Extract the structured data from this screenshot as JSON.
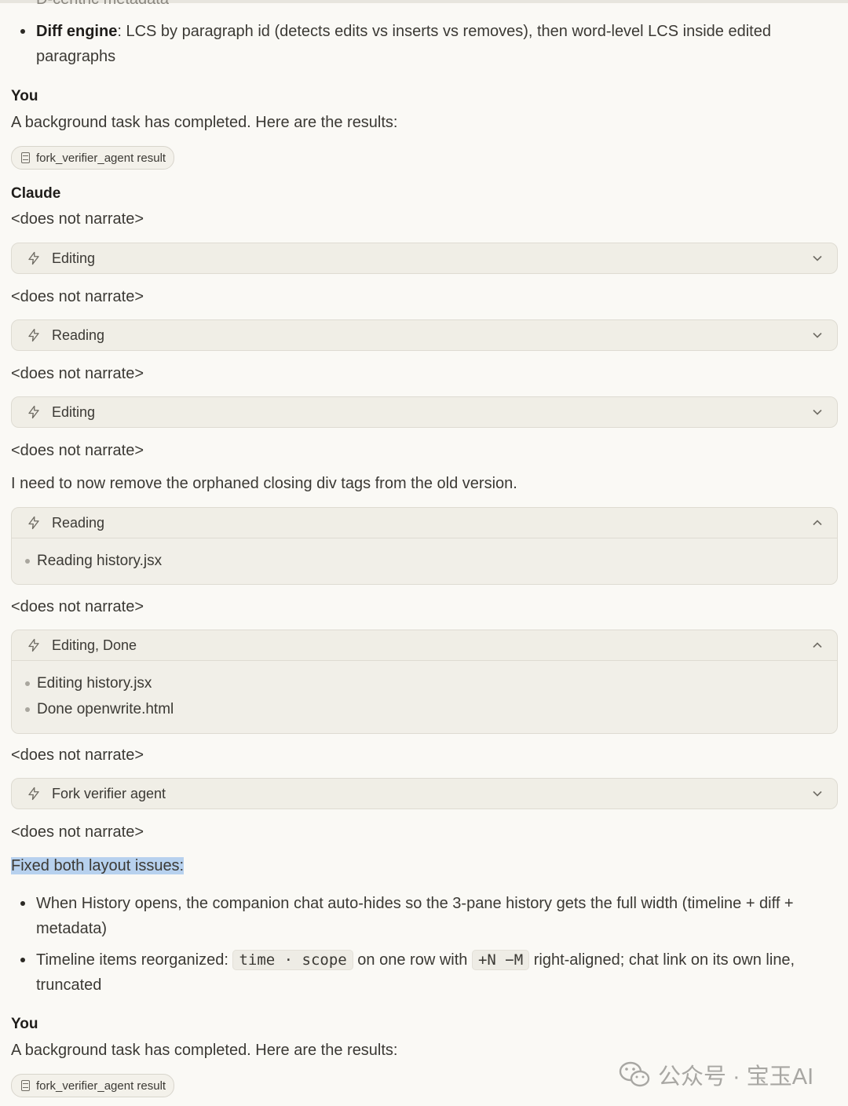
{
  "prev_truncated": "D-centric metadata",
  "diff_bullet": {
    "term": "Diff engine",
    "text": ": LCS by paragraph id (detects edits vs inserts vs removes), then word-level LCS inside edited paragraphs"
  },
  "you1": {
    "speaker": "You",
    "message": "A background task has completed. Here are the results:",
    "attachment": "fork_verifier_agent result"
  },
  "claude": {
    "speaker": "Claude",
    "no_narrate": "<does not narrate>",
    "tool1": "Editing",
    "tool2": "Reading",
    "tool3": "Editing",
    "remark": "I need to now remove the orphaned closing div tags from the old version.",
    "tool4": {
      "label": "Reading",
      "items": [
        "Reading history.jsx"
      ]
    },
    "tool5": {
      "label": "Editing, Done",
      "items": [
        "Editing history.jsx",
        "Done openwrite.html"
      ]
    },
    "tool6": "Fork verifier agent",
    "summary_title": "Fixed both layout issues:",
    "bullet1": "When History opens, the companion chat auto-hides so the 3-pane history gets the full width (timeline + diff + metadata)",
    "bullet2_a": "Timeline items reorganized: ",
    "bullet2_code1": "time · scope",
    "bullet2_b": " on one row with ",
    "bullet2_code2": "+N −M",
    "bullet2_c": " right-aligned; chat link on its own line, truncated"
  },
  "you2": {
    "speaker": "You",
    "message": "A background task has completed. Here are the results:",
    "attachment": "fork_verifier_agent result"
  },
  "watermark": "公众号 · 宝玉AI",
  "icons": {
    "tool": "bolt-icon",
    "attachment": "document-icon",
    "collapsed": "chevron-down-icon",
    "expanded": "chevron-up-icon"
  }
}
